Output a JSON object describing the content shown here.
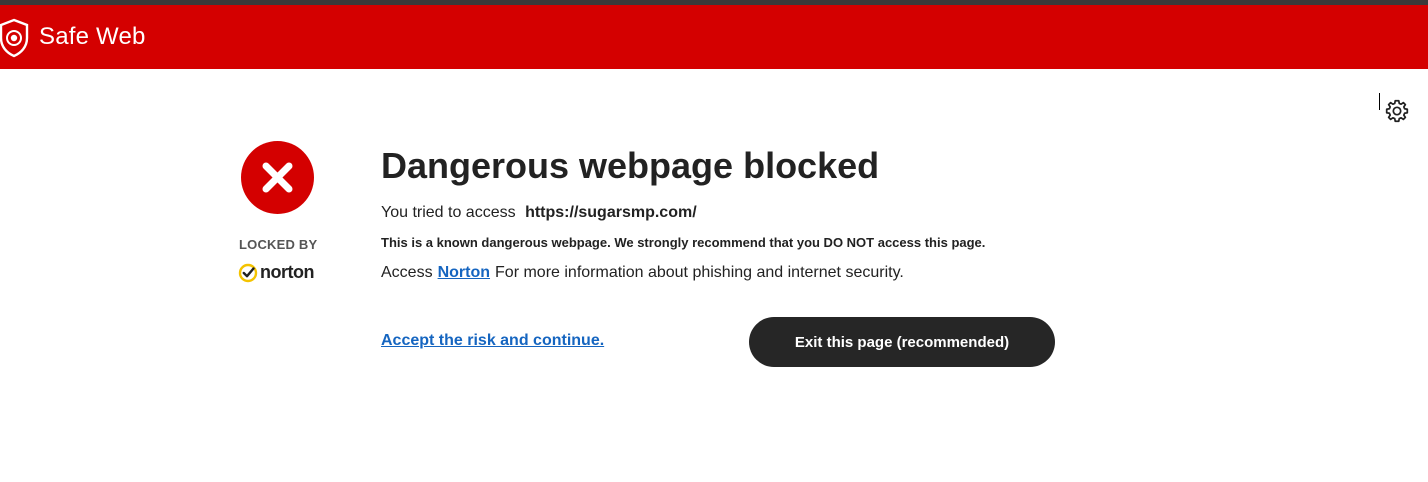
{
  "header": {
    "brand": "Safe Web",
    "logo_icon": "shield-icon",
    "background_color": "#d40000"
  },
  "settings": {
    "icon": "gear-icon"
  },
  "status": {
    "icon": "error-x-icon",
    "locked_by_label": "LOCKED BY",
    "vendor_name": "norton"
  },
  "main": {
    "title": "Dangerous webpage blocked",
    "tried_prefix": "You tried to access",
    "url": "https://sugarsmp.com/",
    "warning": "This is a known dangerous webpage. We strongly recommend that you DO NOT access this page.",
    "access_prefix": "Access",
    "access_link": "Norton",
    "access_suffix": "For more information about phishing and internet security."
  },
  "actions": {
    "accept_label": "Accept the risk and continue.",
    "exit_label": "Exit this page (recommended)"
  },
  "colors": {
    "danger": "#d40000",
    "link": "#1565c0",
    "button_dark": "#262626"
  }
}
